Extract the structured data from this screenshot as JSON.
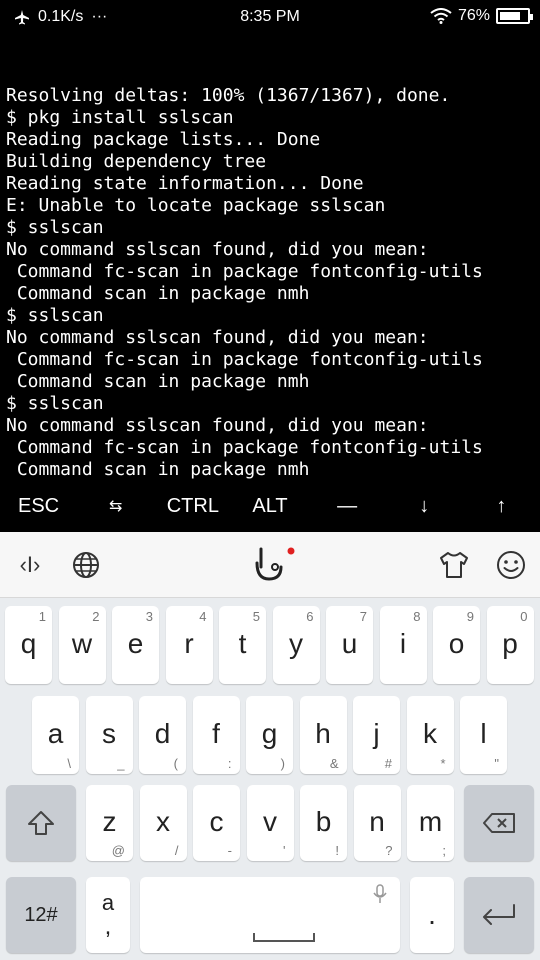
{
  "status_bar": {
    "net_speed": "0.1K/s",
    "dots": "···",
    "time": "8:35 PM",
    "battery_percent": "76%",
    "battery_level": 0.76
  },
  "terminal": {
    "lines": [
      "Resolving deltas: 100% (1367/1367), done.",
      "$ pkg install sslscan",
      "Reading package lists... Done",
      "Building dependency tree",
      "Reading state information... Done",
      "E: Unable to locate package sslscan",
      "$ sslscan",
      "No command sslscan found, did you mean:",
      " Command fc-scan in package fontconfig-utils",
      " Command scan in package nmh",
      "$ sslscan",
      "No command sslscan found, did you mean:",
      " Command fc-scan in package fontconfig-utils",
      " Command scan in package nmh",
      "$ sslscan",
      "No command sslscan found, did you mean:",
      " Command fc-scan in package fontconfig-utils",
      " Command scan in package nmh"
    ],
    "prompt": "$ "
  },
  "extra_keys": {
    "esc": "ESC",
    "tab": "⇆",
    "ctrl": "CTRL",
    "alt": "ALT",
    "dash": "—",
    "down": "↓",
    "up": "↑"
  },
  "keyboard": {
    "toolbar": {
      "cursor_tool": "‹I›",
      "globe": "globe-icon",
      "logo": "touchpal-logo-icon",
      "theme": "shirt-icon",
      "emoji": "smiley-icon"
    },
    "row1": [
      {
        "main": "q",
        "hint": "1"
      },
      {
        "main": "w",
        "hint": "2"
      },
      {
        "main": "e",
        "hint": "3"
      },
      {
        "main": "r",
        "hint": "4"
      },
      {
        "main": "t",
        "hint": "5"
      },
      {
        "main": "y",
        "hint": "6"
      },
      {
        "main": "u",
        "hint": "7"
      },
      {
        "main": "i",
        "hint": "8"
      },
      {
        "main": "o",
        "hint": "9"
      },
      {
        "main": "p",
        "hint": "0"
      }
    ],
    "row2": [
      {
        "main": "a",
        "hint": "\\"
      },
      {
        "main": "s",
        "hint": "_"
      },
      {
        "main": "d",
        "hint": "("
      },
      {
        "main": "f",
        "hint": ":"
      },
      {
        "main": "g",
        "hint": ")"
      },
      {
        "main": "h",
        "hint": "&"
      },
      {
        "main": "j",
        "hint": "#"
      },
      {
        "main": "k",
        "hint": "*"
      },
      {
        "main": "l",
        "hint": "\""
      }
    ],
    "row3": [
      {
        "main": "z",
        "hint": "@"
      },
      {
        "main": "x",
        "hint": "/"
      },
      {
        "main": "c",
        "hint": "-"
      },
      {
        "main": "v",
        "hint": "'"
      },
      {
        "main": "b",
        "hint": "!"
      },
      {
        "main": "n",
        "hint": "?"
      },
      {
        "main": "m",
        "hint": ";"
      }
    ],
    "num_key": "12#",
    "comma_key_top": "a",
    "comma_key_bottom": ",",
    "period_key": "."
  }
}
